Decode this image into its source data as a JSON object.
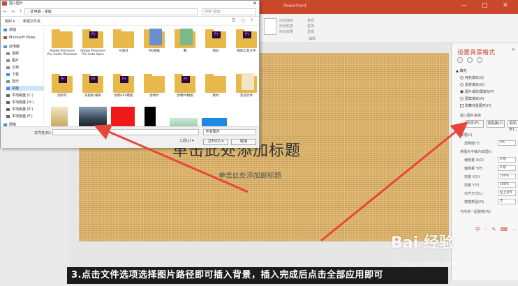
{
  "app": {
    "title": "PowerPoint",
    "window_controls": [
      "—",
      "□",
      "✕"
    ]
  },
  "ribbon": {
    "items": [
      "形状填充",
      "形状轮廓",
      "形状效果",
      "查找",
      "替换",
      "选择",
      "编辑"
    ]
  },
  "slide": {
    "title": "单击此处添加标题",
    "subtitle": "单击此处添加副标题"
  },
  "format_pane": {
    "title": "设置背景格式",
    "close": "✕",
    "section": "▲ 填充",
    "options": [
      "纯色填充(S)",
      "渐变填充(G)",
      "图片或纹理填充(P)",
      "图案填充(A)",
      "隐藏背景图形(H)"
    ],
    "insert_label": "插入图片来自",
    "file_button": "文件(F)...",
    "clipboard_button": "剪贴板(C)",
    "online_button": "联机(E)...",
    "texture_label": "纹理(U)",
    "transparency_label": "透明度(T)",
    "transparency_value": "0%",
    "tile_label": "将图片平铺为纹理(I)",
    "offset_labels": [
      "偏移量 X(O)",
      "偏移量 Y(E)",
      "刻度 X(X)",
      "刻度 Y(Y)",
      "对齐方式(L)",
      "镜像类型(M)"
    ],
    "offset_values": [
      "0 磅",
      "0 磅",
      "100%",
      "100%",
      "左上对齐",
      "无"
    ],
    "rotate_label": "与形状一起旋转(W)",
    "bottom_icons": "中 ◦ ✎ ⌨ ⋯"
  },
  "dialog": {
    "title": "插入图片",
    "close": "✕",
    "nav_arrows": "← → ↑",
    "breadcrumb": "› 此电脑 › 桌面",
    "search_placeholder": "搜索\"桌面\"",
    "toolbar": [
      "组织 ▾",
      "新建文件夹"
    ],
    "toolbar_icons": "☰ ▢ ?",
    "nav_items": [
      "桌面",
      "Microsoft Powe",
      "此电脑",
      "视频",
      "图片",
      "文档",
      "下载",
      "音乐",
      "桌面",
      "本地磁盘 (C:)",
      "本地磁盘 (D:)",
      "本地磁盘 (E:)",
      "本地磁盘 (F:)",
      "网络"
    ],
    "files_row1": [
      "Adobe Premiere Pro Audio Previews",
      "Adobe Premiere Pro Auto-Save",
      "AI素材",
      "MG模板",
      "胸",
      "图标",
      "模拟工具文件"
    ],
    "files_row2": [
      "测试可",
      "双视频-横屏",
      "仿明AEV模板",
      "仿明片",
      "仿明PR模板",
      "素材",
      "完成文件"
    ],
    "file_name_label": "文件名(N):",
    "file_type": "所有图片",
    "tools_button": "工具(L) ▾",
    "open_button": "打开(O) ▾",
    "cancel_button": "取消"
  },
  "caption": "3.点击文件选项选择图片路径即可插入背景，插入完成后点击全部应用即可",
  "watermark": {
    "brand": "Bai 经验",
    "url": "jingyan.baidu.com"
  },
  "colors": {
    "accent": "#c9472b",
    "arrow": "#e8463d",
    "slide_bg": "#dcb46c"
  }
}
